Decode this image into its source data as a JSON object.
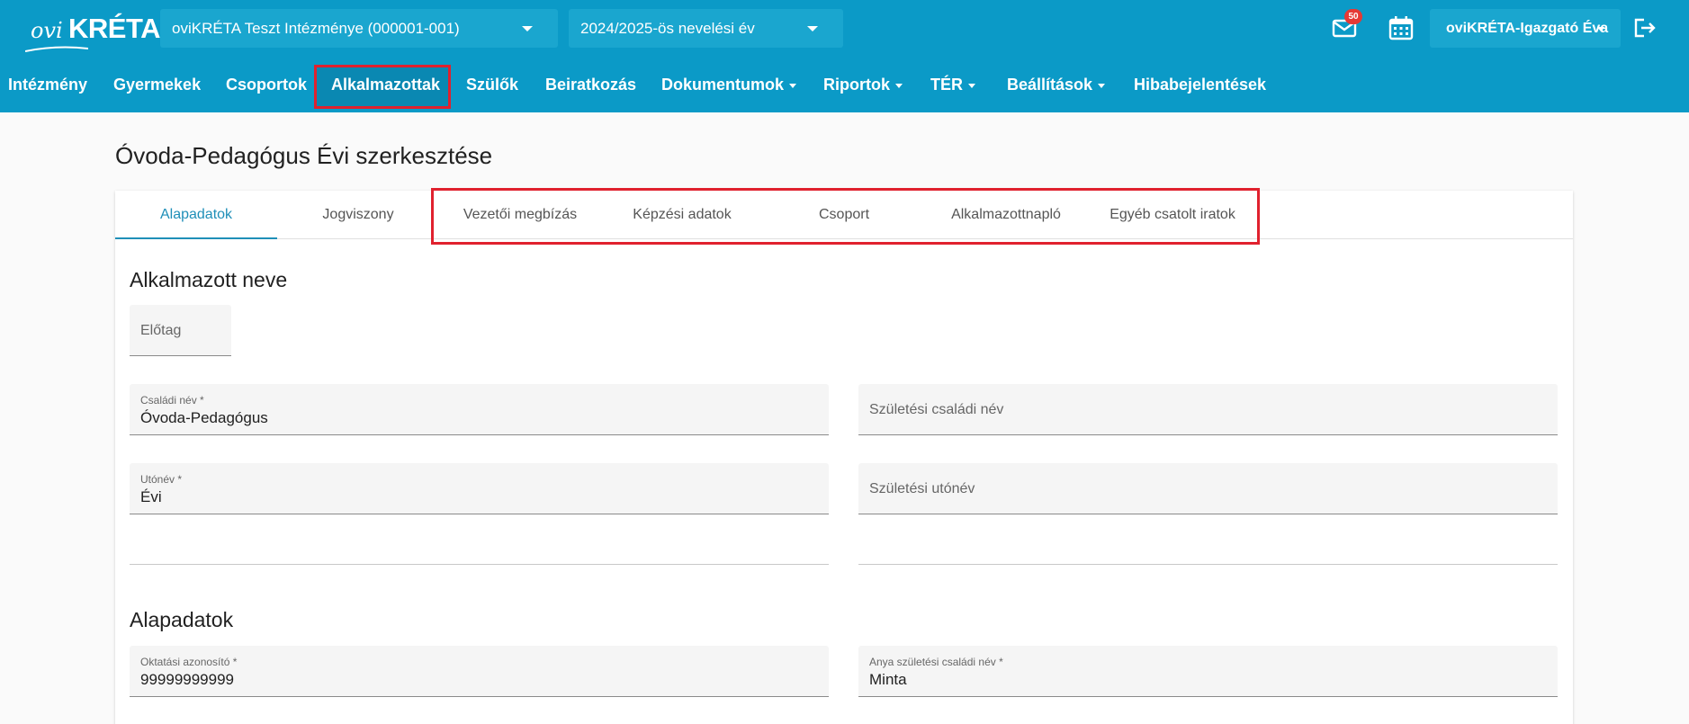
{
  "app": {
    "logo_prefix": "ovi",
    "logo_name": "KRÉTA"
  },
  "header": {
    "institution": "oviKRÉTA Teszt Intézménye (000001-001)",
    "year": "2024/2025-ös nevelési év",
    "mail_count": "50",
    "user": "oviKRÉTA-Igazgató Éva"
  },
  "nav": [
    {
      "label": "Intézmény"
    },
    {
      "label": "Gyermekek"
    },
    {
      "label": "Csoportok"
    },
    {
      "label": "Alkalmazottak"
    },
    {
      "label": "Szülők"
    },
    {
      "label": "Beiratkozás"
    },
    {
      "label": "Dokumentumok"
    },
    {
      "label": "Riportok"
    },
    {
      "label": "TÉR"
    },
    {
      "label": "Beállítások"
    },
    {
      "label": "Hibabejelentések"
    }
  ],
  "page": {
    "title": "Óvoda-Pedagógus Évi szerkesztése"
  },
  "tabs": [
    {
      "label": "Alapadatok"
    },
    {
      "label": "Jogviszony"
    },
    {
      "label": "Vezetői megbízás"
    },
    {
      "label": "Képzési adatok"
    },
    {
      "label": "Csoport"
    },
    {
      "label": "Alkalmazottnapló"
    },
    {
      "label": "Egyéb csatolt iratok"
    }
  ],
  "sections": {
    "name": {
      "title": "Alkalmazott neve",
      "prefix": {
        "placeholder": "Előtag"
      },
      "family": {
        "label": "Családi név *",
        "value": "Óvoda-Pedagógus"
      },
      "birth_family": {
        "placeholder": "Születési családi név"
      },
      "given": {
        "label": "Utónév *",
        "value": "Évi"
      },
      "birth_given": {
        "placeholder": "Születési utónév"
      }
    },
    "basic": {
      "title": "Alapadatok",
      "edu_id": {
        "label": "Oktatási azonosító *",
        "value": "99999999999"
      },
      "mother_name": {
        "label": "Anya születési családi név *",
        "value": "Minta"
      }
    }
  },
  "colors": {
    "brand": "#0b9ac7",
    "highlight": "#e0212e",
    "active_tab": "#1f8fb8",
    "badge": "#e53935"
  }
}
